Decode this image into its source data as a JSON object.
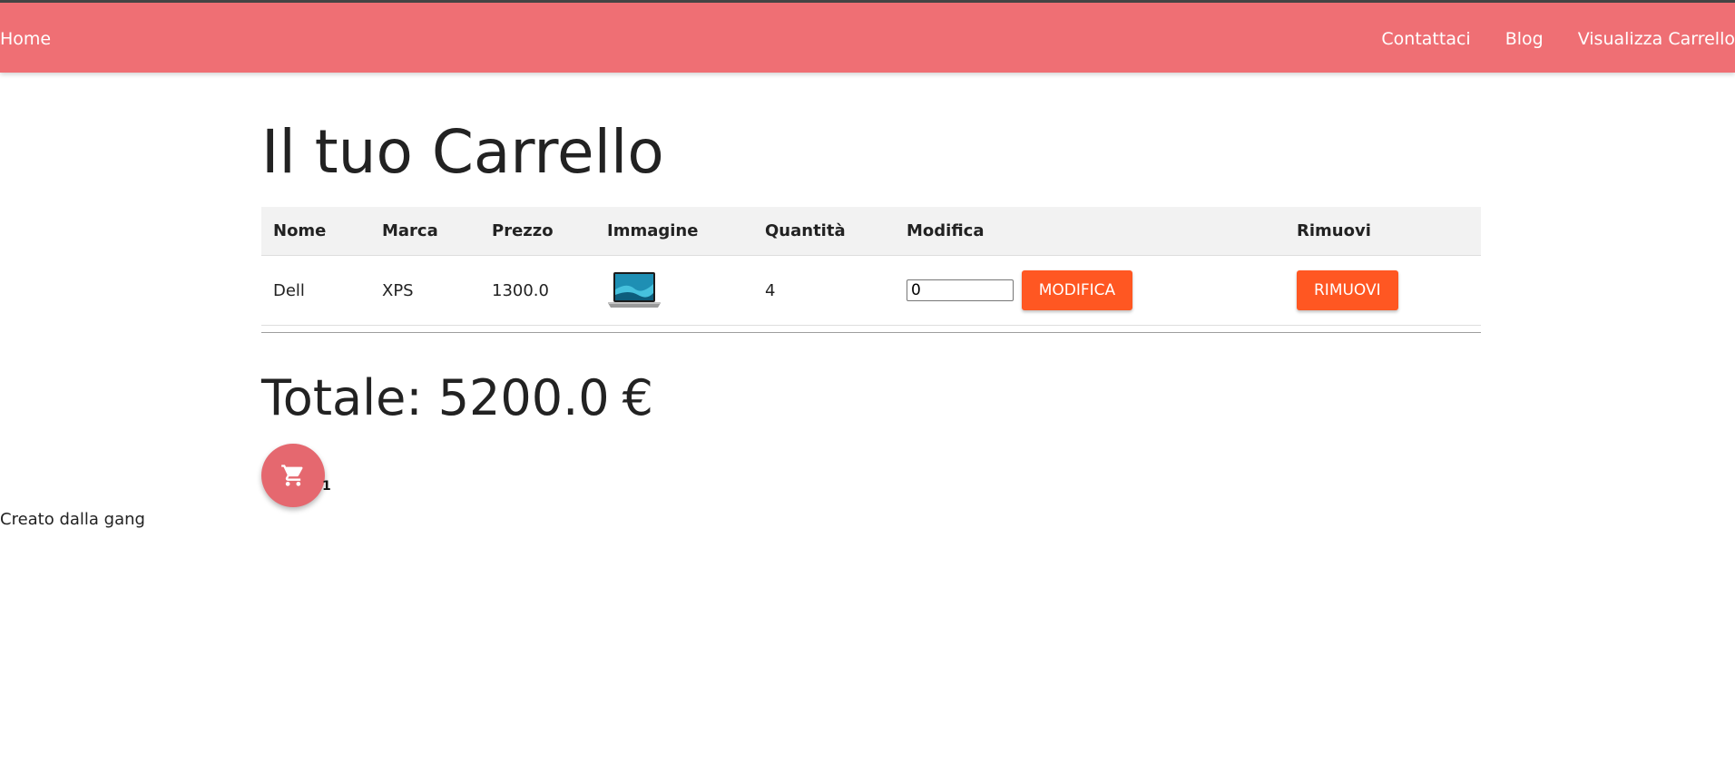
{
  "navbar": {
    "home_label": "Home",
    "links": [
      "Contattaci",
      "Blog",
      "Visualizza Carrello"
    ],
    "background_color": "#ef6f74"
  },
  "page": {
    "title": "Il tuo Carrello"
  },
  "cart_table": {
    "headers": [
      "Nome",
      "Marca",
      "Prezzo",
      "Immagine",
      "Quantità",
      "Modifica",
      "Rimuovi"
    ],
    "rows": [
      {
        "nome": "Dell",
        "marca": "XPS",
        "prezzo": "1300.0",
        "image_icon": "laptop-image",
        "quantita": "4",
        "modifica_input_value": "0",
        "modifica_button": "MODIFICA",
        "rimuovi_button": "RIMUOVI"
      }
    ],
    "button_color": "#ff5722"
  },
  "total": {
    "label": "Totale: 5200.0",
    "currency": "€"
  },
  "cart_fab": {
    "icon": "shopping-cart-icon",
    "count": "1",
    "color": "#e5686f"
  },
  "footer": {
    "text": "Creato dalla gang"
  }
}
